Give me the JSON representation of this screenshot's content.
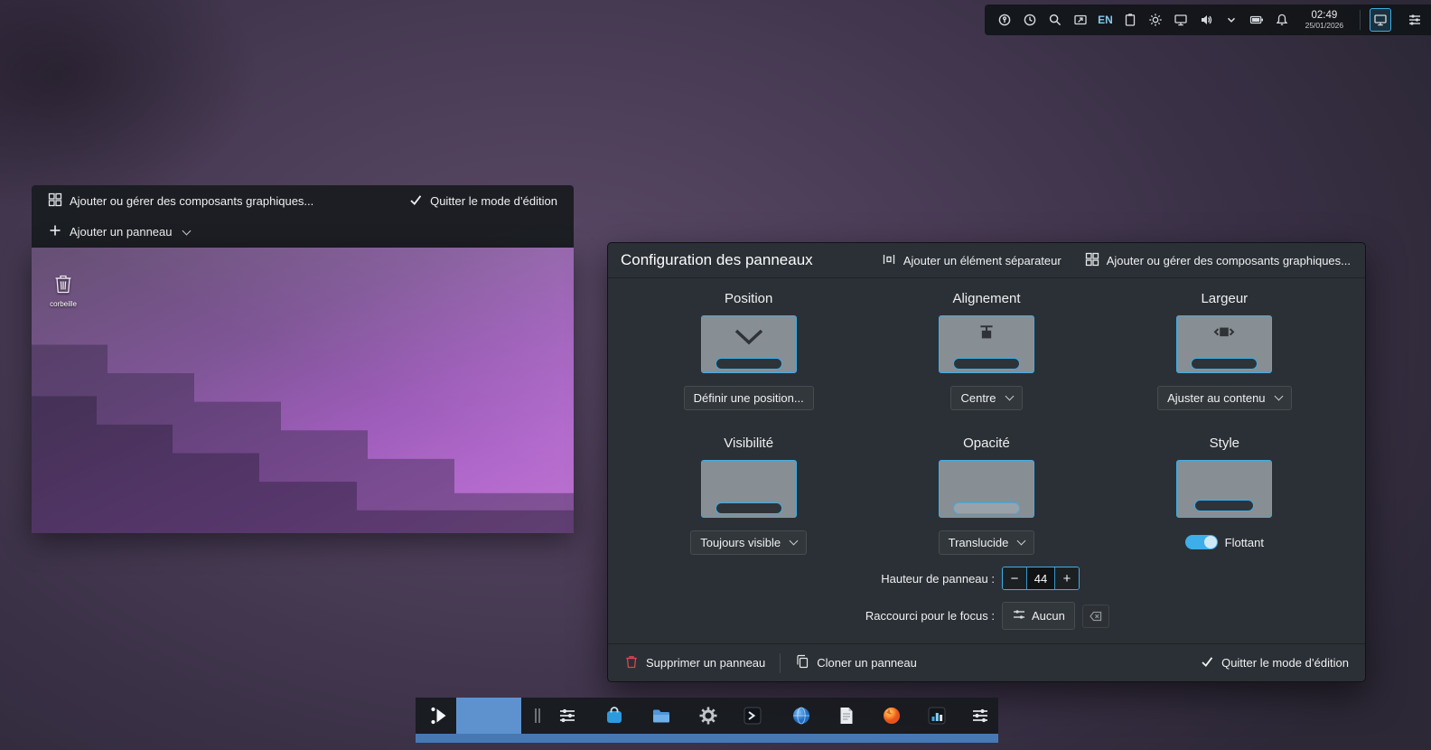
{
  "accent": "#3daee9",
  "edit_toolbar": {
    "manage_widgets": "Ajouter ou gérer des composants graphiques...",
    "exit_edit_mode": "Quitter le mode d’édition",
    "add_panel": "Ajouter un panneau"
  },
  "desktop": {
    "trash_label": "corbeille"
  },
  "tray": {
    "keyboard_layout": "EN",
    "time": "02:49",
    "date": "25/01/2026",
    "icons": [
      "privacy-icon",
      "history-icon",
      "search-icon",
      "screenshare-icon",
      "keyboard-layout-indicator",
      "clipboard-icon",
      "brightness-icon",
      "display-icon",
      "volume-icon",
      "chevron-down-icon",
      "battery-icon",
      "notifications-icon",
      "clock",
      "display-settings-icon",
      "panel-configure-icon"
    ]
  },
  "panel_config": {
    "title": "Configuration des panneaux",
    "add_separator": "Ajouter un élément séparateur",
    "manage_widgets": "Ajouter ou gérer des composants graphiques...",
    "position": {
      "label": "Position",
      "button": "Définir une position..."
    },
    "alignment": {
      "label": "Alignement",
      "value": "Centre"
    },
    "width": {
      "label": "Largeur",
      "value": "Ajuster au contenu"
    },
    "visibility": {
      "label": "Visibilité",
      "value": "Toujours visible"
    },
    "opacity": {
      "label": "Opacité",
      "value": "Translucide"
    },
    "style": {
      "label": "Style",
      "toggle": "Flottant",
      "toggle_state": "on"
    },
    "height_label": "Hauteur de panneau :",
    "height_value": "44",
    "height_minus": "−",
    "height_plus": "+",
    "shortcut_label": "Raccourci pour le focus :",
    "shortcut_value": "Aucun",
    "delete_panel": "Supprimer un panneau",
    "clone_panel": "Cloner un panneau",
    "exit_edit_mode": "Quitter le mode d’édition"
  },
  "taskbar": {
    "apps": [
      "app-launcher",
      "highlighted-spacer",
      "separator-handle",
      "mixer-sliders",
      "discover",
      "file-manager",
      "system-settings",
      "terminal",
      "web-browser",
      "notes",
      "firefox",
      "system-monitor",
      "panel-settings"
    ]
  }
}
